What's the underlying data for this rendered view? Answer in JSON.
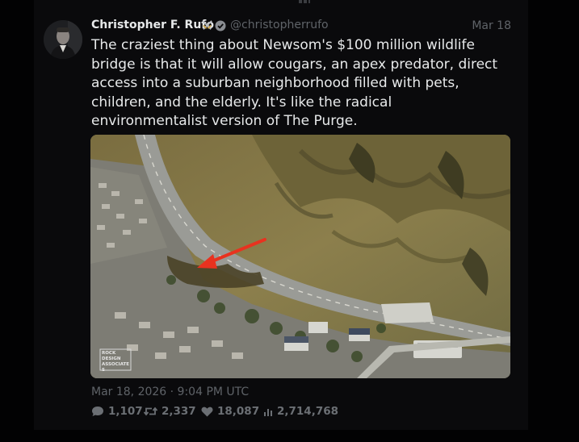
{
  "tweet": {
    "author_name": "Christopher F. Rufo",
    "handle": "@christopherrufo",
    "date": "Mar 18",
    "text": "The craziest thing about Newsom's $100 million wildlife bridge is that it will allow cougars, an apex predator, direct access into a suburban neighborhood filled with pets, children, and the elderly. It's like the radical environmentalist version of The Purge.",
    "timestamp": "Mar 18, 2026 · 9:04 PM UTC",
    "image_watermark": "ROCK DESIGN ASSOCIATES",
    "icons": {
      "author_badge": "crossed-swords-icon",
      "verified": "verified-badge-icon"
    },
    "stats": {
      "replies": "1,107",
      "retweets": "2,337",
      "likes": "18,087",
      "views": "2,714,768"
    }
  },
  "colors": {
    "background": "#020203",
    "text": "#e7e9ea",
    "muted": "#5f6368",
    "arrow": "#e8321f"
  }
}
